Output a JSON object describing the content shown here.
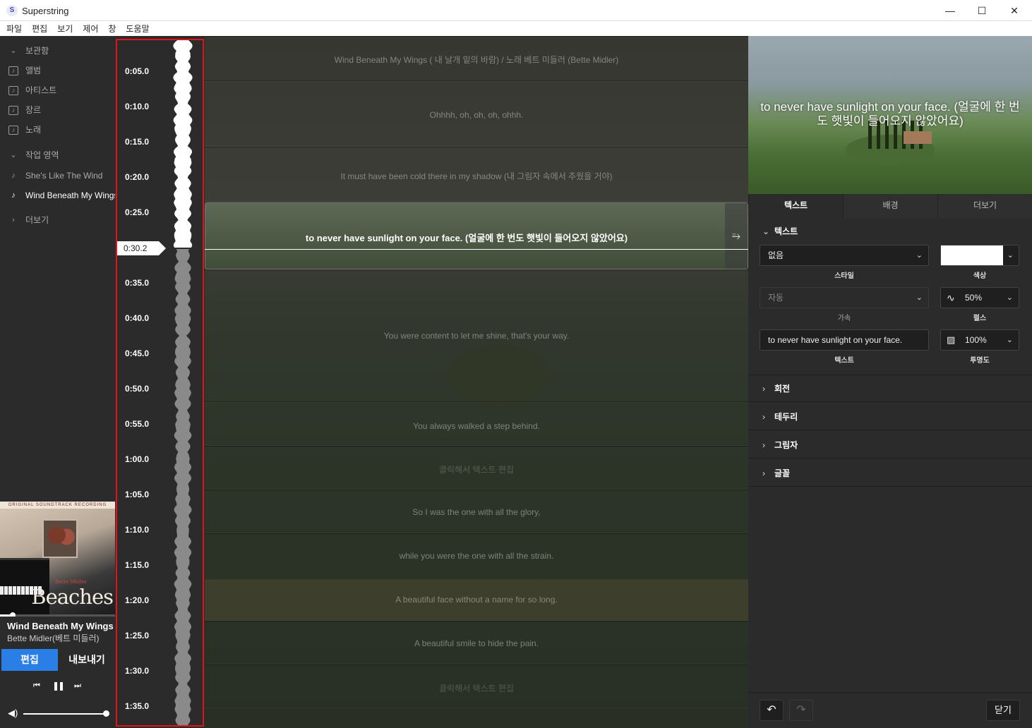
{
  "window": {
    "title": "Superstring",
    "app_icon": "S",
    "minimize": "—",
    "maximize": "☐",
    "close": "✕"
  },
  "menu": [
    "파일",
    "편집",
    "보기",
    "제어",
    "창",
    "도움말"
  ],
  "sidebar": {
    "library": {
      "label": "보관함",
      "items": [
        {
          "label": "앨범",
          "icon": "album-icon"
        },
        {
          "label": "아티스트",
          "icon": "artist-icon"
        },
        {
          "label": "장르",
          "icon": "genre-icon"
        },
        {
          "label": "노래",
          "icon": "song-icon"
        }
      ]
    },
    "workspace": {
      "label": "작업 영역",
      "items": [
        {
          "label": "She's Like The Wind",
          "active": false
        },
        {
          "label": "Wind Beneath My Wings",
          "active": true
        }
      ]
    },
    "more": "더보기"
  },
  "album_art": {
    "banner": "ORIGINAL SOUNDTRACK RECORDING",
    "artist_script": "Bette Midler",
    "title": "Beaches"
  },
  "now_playing": {
    "title": "Wind Beneath My Wings",
    "artist": "Bette Midler(베트 미들러)",
    "progress": 0.11
  },
  "modes": {
    "edit": "편집",
    "export": "내보내기"
  },
  "transport": {
    "prev": "⏮",
    "pause": "❚❚",
    "next": "⏭"
  },
  "volume": {
    "icon": "🔊",
    "level": 1.0
  },
  "timeline": {
    "ticks": [
      "0:05.0",
      "0:10.0",
      "0:15.0",
      "0:20.0",
      "0:25.0",
      "0:35.0",
      "0:40.0",
      "0:45.0",
      "0:50.0",
      "0:55.0",
      "1:00.0",
      "1:05.0",
      "1:10.0",
      "1:15.0",
      "1:20.0",
      "1:25.0",
      "1:30.0",
      "1:35.0"
    ],
    "playhead": "0:30.2"
  },
  "lyrics": {
    "blocks": [
      {
        "text": "Wind Beneath My Wings ( 내 날개  밑의 바람) / 노래 베트 미들러 (Bette Midler)",
        "placeholder": false
      },
      {
        "text": "Ohhhh, oh, oh, oh, ohhh.",
        "placeholder": false
      },
      {
        "text": "It must have been cold there in my shadow (내 그림자 속에서 추웠을 거야)",
        "placeholder": false
      },
      {
        "text": "You were content to let me shine, that's your way.",
        "placeholder": false
      },
      {
        "text": "You always walked a step behind.",
        "placeholder": false
      },
      {
        "text": "클릭해서 텍스트 편집",
        "placeholder": true
      },
      {
        "text": "So I was the one with all the glory,",
        "placeholder": false
      },
      {
        "text": "while you were the one with all the strain.",
        "placeholder": false
      },
      {
        "text": "A beautiful face without a name for so long.",
        "placeholder": false
      },
      {
        "text": "A beautiful smile to hide the pain.",
        "placeholder": false
      },
      {
        "text": "클릭해서 텍스트 편집",
        "placeholder": true
      }
    ],
    "active": "to never have sunlight on your face. (얼굴에 한 번도 햇빛이 들어오지  않았어요)"
  },
  "preview": {
    "text": "to never have sunlight on your face. (얼굴에 한 번도 햇빛이 들어오지  않았어요)"
  },
  "tabs": [
    "텍스트",
    "배경",
    "더보기"
  ],
  "text_section": {
    "title": "텍스트",
    "style": {
      "value": "없음",
      "label": "스타일"
    },
    "color": {
      "value": "#ffffff",
      "label": "색상"
    },
    "lyrics_mode": {
      "value": "자동",
      "label": "가속"
    },
    "pulse": {
      "value": "50%",
      "label": "펄스"
    },
    "text": {
      "value": "to never have sunlight on your face.",
      "label": "텍스트"
    },
    "opacity": {
      "value": "100%",
      "label": "투명도"
    }
  },
  "collapsed_sections": [
    "회전",
    "테두리",
    "그림자",
    "글꼴"
  ],
  "footer": {
    "undo": "↶",
    "redo": "↷",
    "close": "닫기"
  }
}
